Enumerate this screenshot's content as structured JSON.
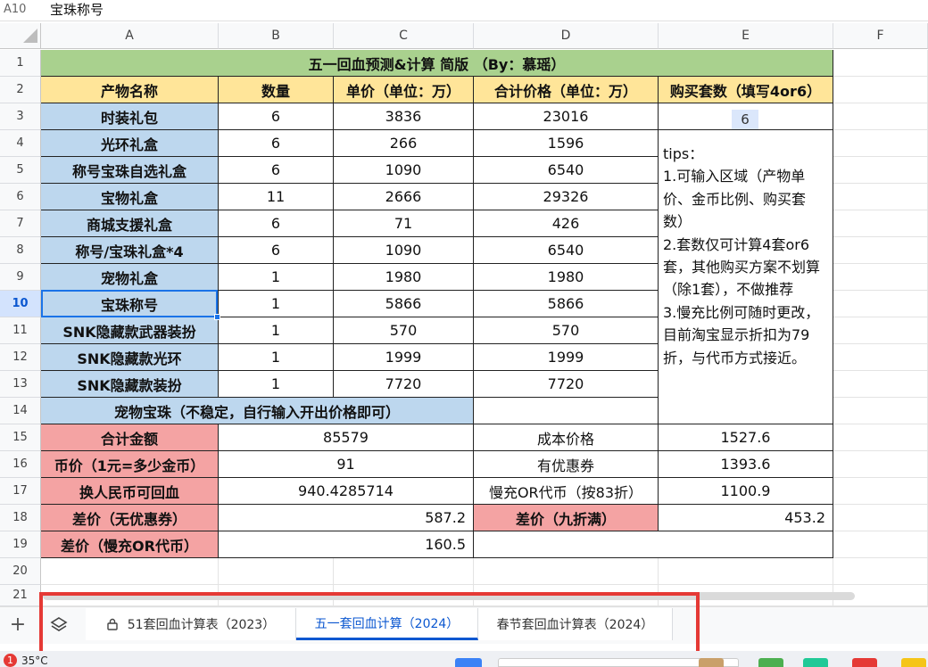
{
  "formula_bar": {
    "cell_ref": "A10",
    "content": "宝珠称号"
  },
  "columns": [
    "A",
    "B",
    "C",
    "D",
    "E",
    "F"
  ],
  "rows": [
    "1",
    "2",
    "3",
    "4",
    "5",
    "6",
    "7",
    "8",
    "9",
    "10",
    "11",
    "12",
    "13",
    "14",
    "15",
    "16",
    "17",
    "18",
    "19",
    "20",
    "21"
  ],
  "sheet": {
    "title": "五一回血预测&计算 简版 （By：慕瑶）",
    "headers": [
      "产物名称",
      "数量",
      "单价（单位：万）",
      "合计价格（单位：万）",
      "购买套数（填写4or6）"
    ],
    "items": [
      {
        "name": "时装礼包",
        "qty": "6",
        "price": "3836",
        "total": "23016"
      },
      {
        "name": "光环礼盒",
        "qty": "6",
        "price": "266",
        "total": "1596"
      },
      {
        "name": "称号宝珠自选礼盒",
        "qty": "6",
        "price": "1090",
        "total": "6540"
      },
      {
        "name": "宝物礼盒",
        "qty": "11",
        "price": "2666",
        "total": "29326"
      },
      {
        "name": "商城支援礼盒",
        "qty": "6",
        "price": "71",
        "total": "426"
      },
      {
        "name": "称号/宝珠礼盒*4",
        "qty": "6",
        "price": "1090",
        "total": "6540"
      },
      {
        "name": "宠物礼盒",
        "qty": "1",
        "price": "1980",
        "total": "1980"
      },
      {
        "name": "宝珠称号",
        "qty": "1",
        "price": "5866",
        "total": "5866"
      },
      {
        "name": "SNK隐藏款武器装扮",
        "qty": "1",
        "price": "570",
        "total": "570"
      },
      {
        "name": "SNK隐藏款光环",
        "qty": "1",
        "price": "1999",
        "total": "1999"
      },
      {
        "name": "SNK隐藏款装扮",
        "qty": "1",
        "price": "7720",
        "total": "7720"
      }
    ],
    "buy_sets": "6",
    "tips": "tips：\n1.可输入区域（产物单价、金币比例、购买套数）\n2.套数仅可计算4套or6套，其他购买方案不划算（除1套），不做推荐\n3.慢充比例可随时更改，目前淘宝显示折扣为79折，与代币方式接近。",
    "pet_gem": "宠物宝珠（不稳定，自行输入开出价格即可）",
    "total_label": "合计金额",
    "total_value": "85579",
    "cost_label": "成本价格",
    "cost_value": "1527.6",
    "rate_label": "币价（1元=多少金币）",
    "rate_value": "91",
    "coupon_label": "有优惠券",
    "coupon_value": "1393.6",
    "rmb_label": "换人民币可回血",
    "rmb_value": "940.4285714",
    "slow_label": "慢充OR代币（按83折）",
    "slow_value": "1100.9",
    "diff1_label": "差价（无优惠券）",
    "diff1_value": "587.2",
    "diff2_label": "差价（九折满）",
    "diff2_value": "453.2",
    "diff3_label": "差价（慢充OR代币）",
    "diff3_value": "160.5"
  },
  "tabs": [
    {
      "label": "51套回血计算表（2023）",
      "locked": true
    },
    {
      "label": "五一套回血计算（2024）",
      "active": true
    },
    {
      "label": "春节套回血计算表（2024）"
    }
  ],
  "taskbar": {
    "badge": "1",
    "temp": "35°C"
  },
  "icons": {
    "add": "+",
    "lock": "lock-icon",
    "layers": "layers-icon"
  },
  "colors": {
    "green": "#a9d18e",
    "yellow": "#ffe599",
    "blue": "#bdd7ee",
    "pink": "#f4a3a3",
    "accent": "#0b57d0",
    "highlight": "#e53935"
  }
}
